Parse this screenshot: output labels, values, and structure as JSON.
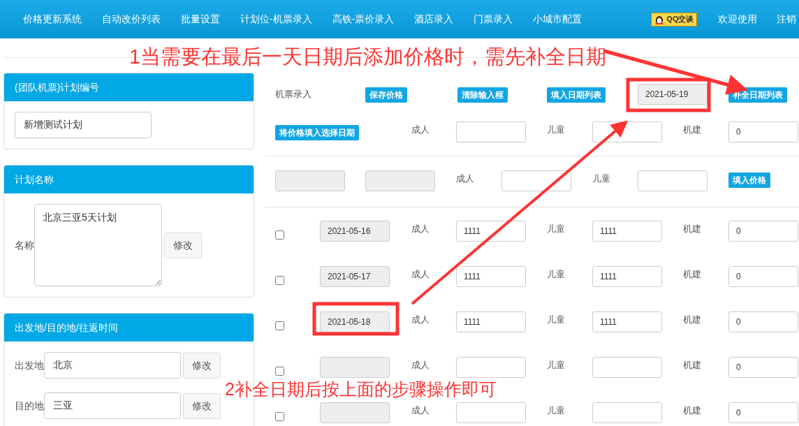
{
  "nav": {
    "items": [
      "价格更新系统",
      "自动改价列表",
      "批量设置",
      "计划位-机票录入",
      "高铁-票价录入",
      "酒店录入",
      "门票录入",
      "小城市配置"
    ],
    "qq_button": "QQ交谈",
    "welcome": "欢迎使用",
    "logout": "注销"
  },
  "plan_number": {
    "title": "(团队机票)计划编号",
    "value": "新增测试计划"
  },
  "plan_name": {
    "title": "计划名称",
    "label": "名称",
    "value": "北京三亚5天计划",
    "button": "修改"
  },
  "route": {
    "title": "出发地/目的地/往返时间",
    "fields": [
      {
        "label": "出发地",
        "value": "北京",
        "button": "修改"
      },
      {
        "label": "目的地",
        "value": "三亚",
        "button": "修改"
      }
    ]
  },
  "toolbar": {
    "label": "机票录入",
    "buttons": [
      "保存价格",
      "清除输入框",
      "填入日期列表"
    ],
    "last_date": "2021-05-19",
    "fill_button": "补全日期列表"
  },
  "batch": {
    "button": "将价格填入选择日期",
    "adult_label": "成人",
    "child_label": "儿童",
    "tax_label": "机建",
    "tax": "0"
  },
  "quick": {
    "adult_label": "成人",
    "child_label": "儿童",
    "button": "填入价格"
  },
  "rows": [
    {
      "checked": false,
      "date": "2021-05-16",
      "adult_label": "成人",
      "adult": "1111",
      "child_label": "儿童",
      "child": "1111",
      "tax_label": "机建",
      "tax": "0"
    },
    {
      "checked": false,
      "date": "2021-05-17",
      "adult_label": "成人",
      "adult": "1111",
      "child_label": "儿童",
      "child": "1111",
      "tax_label": "机建",
      "tax": "0"
    },
    {
      "checked": false,
      "date": "2021-05-18",
      "adult_label": "成人",
      "adult": "1111",
      "child_label": "儿童",
      "child": "1111",
      "tax_label": "机建",
      "tax": "0"
    },
    {
      "checked": false,
      "adult_label": "成人",
      "child_label": "儿童",
      "tax_label": "机建",
      "tax": "0"
    },
    {
      "checked": false,
      "adult_label": "成人",
      "child_label": "儿童",
      "tax_label": "机建",
      "tax": "0"
    }
  ],
  "annotations": [
    "1当需要在最后一天日期后添加价格时，需先补全日期",
    "2补全日期后按上面的步骤操作即可"
  ]
}
